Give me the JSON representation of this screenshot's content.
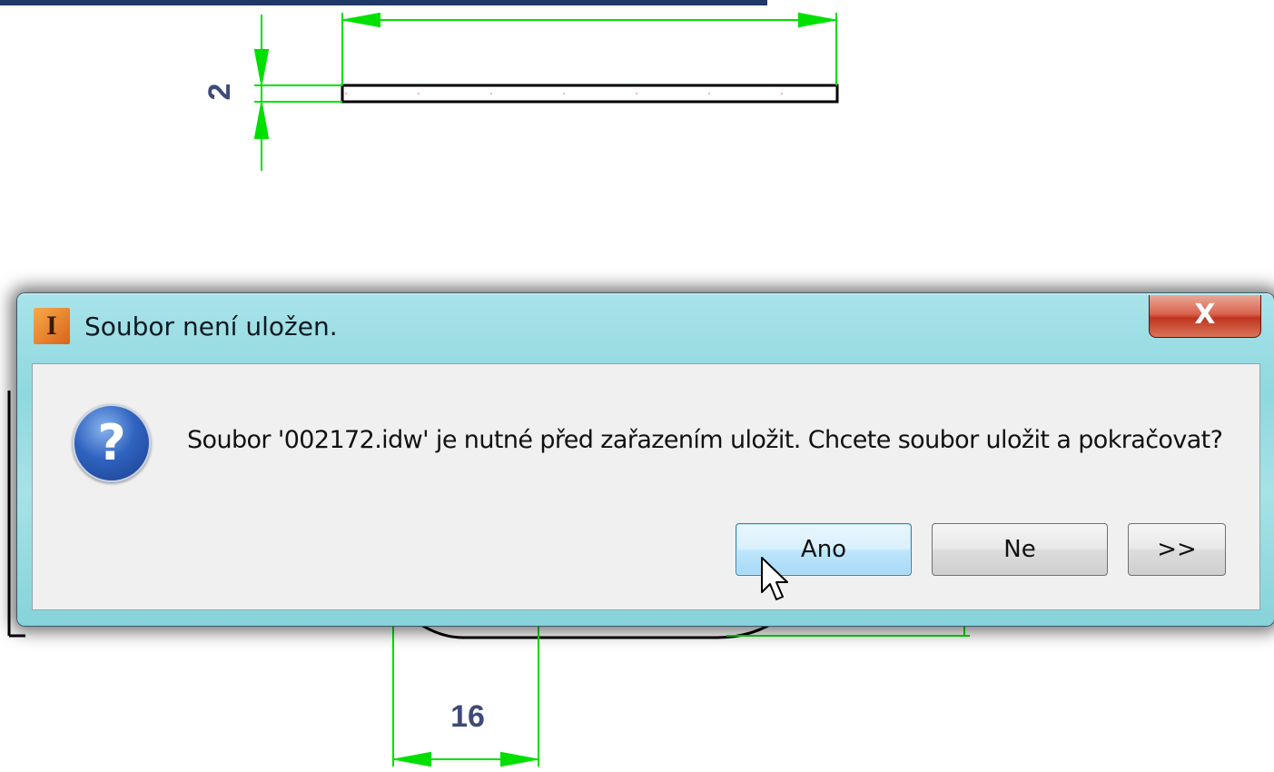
{
  "drawing": {
    "dim_thickness": "2",
    "dim_bottom": "16"
  },
  "dialog": {
    "title": "Soubor není uložen.",
    "app_icon_letter": "I",
    "close_label": "X",
    "icon": "question-icon",
    "message": "Soubor '002172.idw' je nutné před zařazením uložit. Chcete soubor uložit a pokračovat?",
    "buttons": {
      "yes": "Ano",
      "no": "Ne",
      "more": ">>"
    }
  },
  "colors": {
    "dimension": "#00e000",
    "dimension_text": "#3f4a78",
    "dialog_frame": "#94dbe1",
    "close_button": "#c9452d"
  }
}
